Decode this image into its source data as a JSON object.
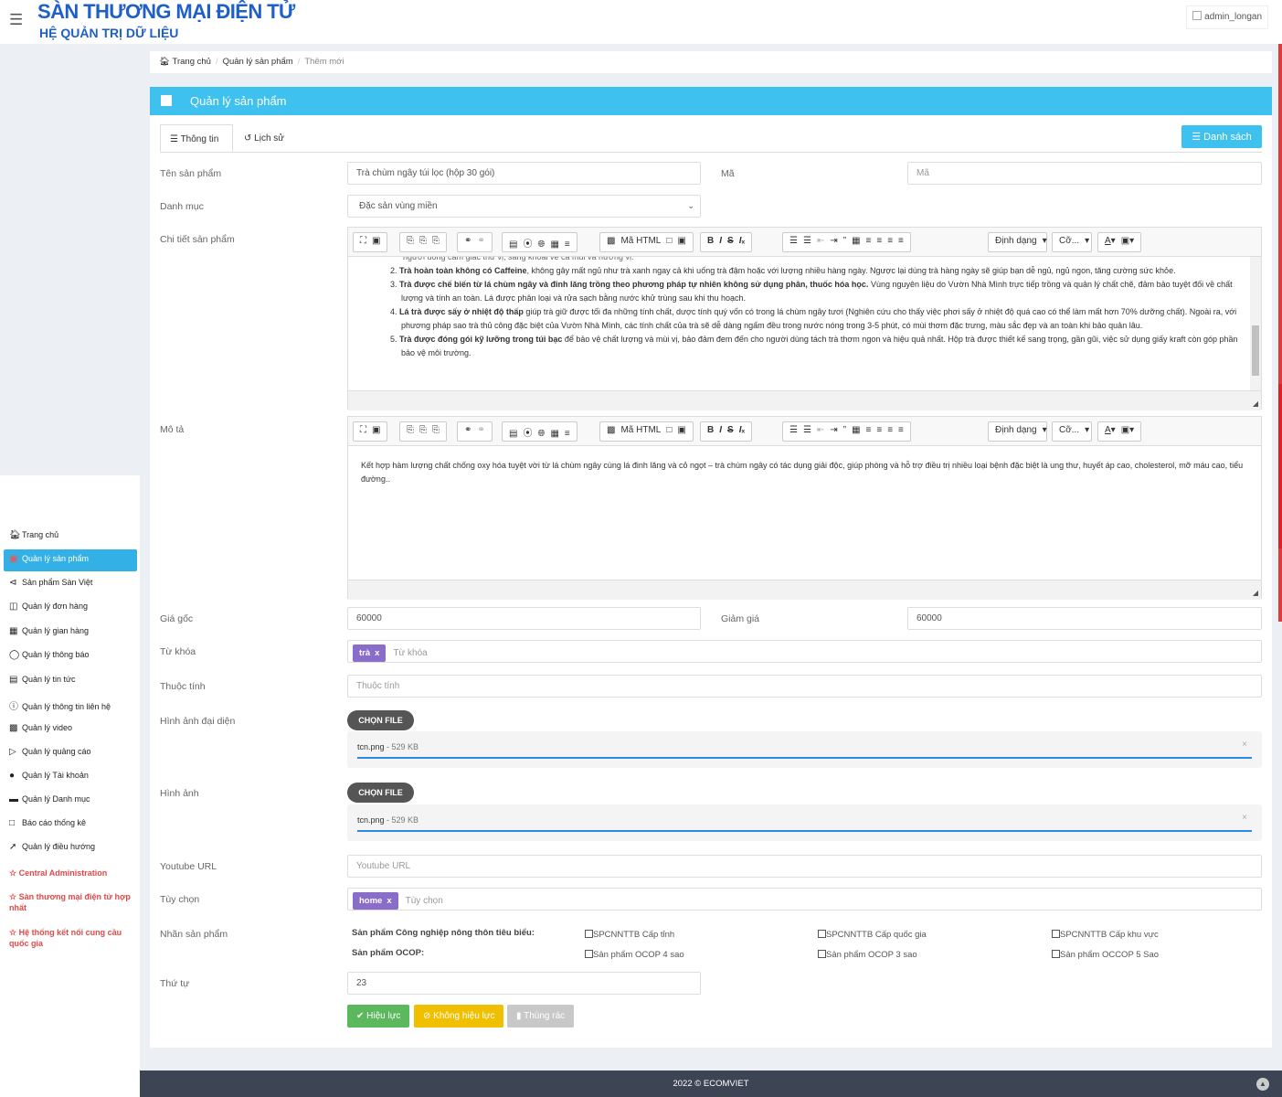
{
  "header": {
    "brand_title": "SÀN THƯƠNG MẠI ĐIỆN TỬ",
    "brand_subtitle": "HỆ QUẢN TRỊ DỮ LIỆU",
    "user": "admin_longan"
  },
  "sidebar": {
    "items": [
      {
        "icon": "home-icon",
        "label": "Trang chủ"
      },
      {
        "icon": "archive-icon",
        "label": "Quản lý sản phẩm",
        "active": true
      },
      {
        "icon": "share-icon",
        "label": "Sản phẩm Sàn Việt"
      },
      {
        "icon": "cart-icon",
        "label": "Quản lý đơn hàng"
      },
      {
        "icon": "id-card-icon",
        "label": "Quản lý gian hàng"
      },
      {
        "icon": "bookmark-icon",
        "label": "Quản lý thông báo"
      },
      {
        "icon": "newspaper-icon",
        "label": "Quản lý tin tức"
      },
      {
        "icon": "question-circle-icon",
        "label": "Quản lý thông tin liên hệ"
      },
      {
        "icon": "video-icon",
        "label": "Quản lý video"
      },
      {
        "icon": "bullhorn-icon",
        "label": "Quản lý quảng cáo"
      },
      {
        "icon": "users-icon",
        "label": "Quản lý Tài khoản"
      },
      {
        "icon": "folder-icon",
        "label": "Quản lý Danh mục"
      },
      {
        "icon": "file-icon",
        "label": "Báo cáo thống kê"
      },
      {
        "icon": "location-arrow-icon",
        "label": "Quản lý điều hướng"
      }
    ],
    "links": [
      "Central Administration",
      "Sàn thương mại điện tử hợp nhất",
      "Hệ thống kết nối cung cầu quốc gia"
    ]
  },
  "breadcrumb": {
    "home": "Trang chủ",
    "section": "Quản lý sản phẩm",
    "current": "Thêm mới"
  },
  "panel": {
    "title": "Quản lý sản phẩm",
    "tab_info": "Thông tin",
    "tab_history": "Lịch sử",
    "list_button": "Danh sách"
  },
  "form": {
    "name_label": "Tên sản phẩm",
    "name_value": "Trà chùm ngây túi lọc (hộp 30 gói)",
    "code_label": "Mã",
    "code_placeholder": "Mã",
    "category_label": "Danh mục",
    "category_value": "Đặc sản vùng miền",
    "detail_label": "Chi tiết sản phẩm",
    "desc_label": "Mô tả",
    "price_label": "Giá gốc",
    "price_value": "60000",
    "discount_label": "Giảm giá",
    "discount_value": "60000",
    "keyword_label": "Từ khóa",
    "keyword_tag": "trà",
    "keyword_placeholder": "Từ khóa",
    "attribute_label": "Thuộc tính",
    "attribute_placeholder": "Thuộc tính",
    "avatar_label": "Hình ảnh đại diện",
    "image_label": "Hình ảnh",
    "choose_file": "CHỌN FILE",
    "avatar_file": "tcn.png",
    "avatar_size": " - 529 KB",
    "image_file": "tcn.png",
    "image_size": " - 529 KB",
    "youtube_label": "Youtube URL",
    "youtube_placeholder": "Youtube URL",
    "option_label": "Tùy chọn",
    "option_tag": "home",
    "option_placeholder": "Tùy chọn",
    "badge_label": "Nhãn sản phẩm",
    "badge_group1": "Sản phẩm Công nghiệp nông thôn tiêu biểu:",
    "badge_group2": "Sản phẩm OCOP:",
    "badges1": [
      "SPCNNTTB Cấp tỉnh",
      "SPCNNTTB Cấp quốc gia",
      "SPCNNTTB Cấp khu vực"
    ],
    "badges2": [
      "Sản phẩm OCOP 4 sao",
      "Sản phẩm OCOP 3 sao",
      "Sản phẩm OCCOP 5 Sao"
    ],
    "order_label": "Thứ tự",
    "order_value": "23"
  },
  "editor_toolbar": {
    "html_label": "Mã HTML",
    "format_label": "Định dạng",
    "size_label": "Cỡ..."
  },
  "detail_text": {
    "top_cut": "người uống cảm giác thư vị, sảng khoái về cả mùi và hương vị.",
    "items": [
      {
        "num": "2.",
        "bold": "Trà hoàn toàn không có Caffeine",
        "text": ", không gây mất ngủ như trà xanh ngay cả khi uống trà đậm hoặc với lượng nhiều hàng ngày. Ngược lại dùng trà hàng ngày sẽ giúp bạn dễ ngủ, ngủ ngon, tăng cường sức khỏe."
      },
      {
        "num": "3.",
        "bold": "Trà được chế biến từ lá chùm ngây và đinh lăng trồng theo phương pháp tự nhiên không sử dụng phân, thuốc hóa học.",
        "text": " Vùng nguyên liệu do Vườn Nhà Mình trực tiếp trồng và quản lý chất chẽ, đảm bảo tuyệt đối về chất lượng và tính an toàn. Lá được phân loại và rửa sạch bằng nước khử trùng sau khi thu hoạch."
      },
      {
        "num": "4.",
        "bold": "Lá trà được sấy ở nhiệt độ thấp",
        "text": " giúp trà giữ được tối đa những tính chất, dược tính quý vốn có trong lá chùm ngây tươi (Nghiên cứu cho thấy việc phơi sấy ở nhiệt độ quá cao có thể làm mất hơn 70% dưỡng chất). Ngoài ra, với phương pháp sao trà thủ công đặc biệt của Vườn Nhà Mình, các tính chất của trà sẽ dễ dàng ngấm đều trong nước nóng trong 3-5 phút, có mùi thơm đặc trưng, màu sắc đẹp và an toàn khi bảo quản lâu."
      },
      {
        "num": "5.",
        "bold": "Trà được đóng gói kỹ lưỡng trong túi bạc",
        "text": " để bảo vệ chất lượng và mùi vị, bảo đảm đem đến cho người dùng tách trà thơm ngon và hiệu quả nhất. Hộp trà được thiết kế sang trọng, gần gũi, việc sử dụng giấy kraft còn góp phần bảo vệ môi trường."
      }
    ]
  },
  "desc_text": "Kết hợp hàm lượng chất chống oxy hóa tuyệt vời từ lá chùm ngây cùng lá đinh lăng và cỏ ngọt – trà chùm ngây có tác dụng giải độc, giúp phòng và hỗ trợ điều trị nhiều loại bệnh đặc biệt là ung thư, huyết áp cao, cholesterol, mỡ máu cao, tiểu đường..",
  "actions": {
    "active": "Hiệu lực",
    "inactive": "Không hiệu lực",
    "trash": "Thùng rác"
  },
  "colors": {
    "brand": "#1f5fc9",
    "accent": "#3ec1ee",
    "tag": "#8a6cc9",
    "success": "#5cb85c",
    "warning": "#f0c000",
    "danger": "#e04848"
  },
  "footer": "2022 © ECOMVIET"
}
